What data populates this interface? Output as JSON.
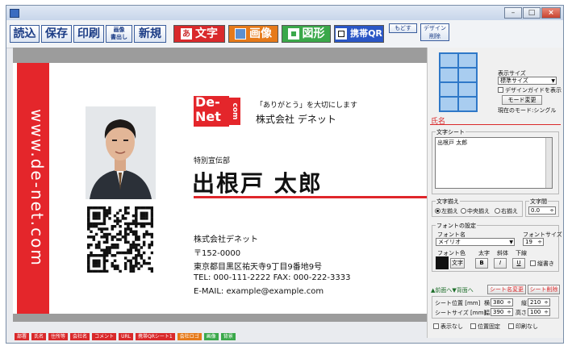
{
  "toolbar": {
    "load": "読込",
    "save": "保存",
    "print": "印刷",
    "export_image_l1": "画像",
    "export_image_l2": "書出し",
    "new": "新規",
    "text_icon": "あ",
    "text": "文字",
    "image": "画像",
    "shape": "図形",
    "qr": "携帯QR",
    "undo": "もどす",
    "design_delete_l1": "デザイン",
    "design_delete_l2": "削除"
  },
  "card": {
    "url": "www.de-net.com",
    "logo_line1": "De-",
    "logo_line2": "Net",
    "logo_com": "com",
    "tagline": "「ありがとう」を大切にします",
    "company_header": "株式会社 デネット",
    "department": "特別宣伝部",
    "name": "出根戸 太郎",
    "company": "株式会社デネット",
    "postal": "〒152-0000",
    "address": "東京都目黒区祐天寺9丁目9番地9号",
    "tel_fax": "TEL: 000-111-2222  FAX: 000-222-3333",
    "email": "E-MAIL: example@example.com"
  },
  "panel": {
    "display_size_label": "表示サイズ",
    "display_size_value": "標準サイズ",
    "design_guide": "デザインガイドを表示",
    "mode_change": "モード変更",
    "current_mode": "現在のモード:シングル",
    "section_name": "氏名",
    "text_sheet_label": "文字シート",
    "text_sheet_value": "出根戸 太郎",
    "align_label": "文字揃え",
    "align_left": "左揃え",
    "align_center": "中央揃え",
    "align_right": "右揃え",
    "spacing_label": "文字間",
    "spacing_value": "0.0",
    "font_settings_label": "フォントの設定",
    "font_name_label": "フォント名",
    "font_name_value": "メイリオ",
    "font_size_label": "フォントサイズ",
    "font_size_value": "19",
    "font_color_label": "フォント色",
    "bold_label": "太字",
    "italic_label": "斜体",
    "underline_label": "下線",
    "font_color_btn": "文字",
    "bold_btn": "B",
    "italic_btn": "I",
    "underline_btn": "U",
    "vertical_label": "縦書き",
    "nav_front_back": "▲前面へ▼背面へ",
    "rename_sheet": "シート名変更",
    "delete_sheet": "シート削除",
    "sheet_pos_label": "シート位置 [mm]",
    "horiz_label": "横",
    "vert_label": "縦",
    "pos_x": "380",
    "pos_y": "210",
    "sheet_size_label": "シートサイズ [mm]",
    "width_label": "幅",
    "height_label": "高さ",
    "size_w": "390",
    "size_h": "100",
    "hide_label": "表示なし",
    "lock_pos_label": "位置固定",
    "no_print_label": "印刷なし"
  },
  "tags": [
    {
      "label": "部署",
      "color": "#d9292b"
    },
    {
      "label": "氏名",
      "color": "#d9292b"
    },
    {
      "label": "住所等",
      "color": "#d9292b"
    },
    {
      "label": "会社名",
      "color": "#d9292b"
    },
    {
      "label": "コメント",
      "color": "#d9292b"
    },
    {
      "label": "URL",
      "color": "#d9292b"
    },
    {
      "label": "携帯QRシート1",
      "color": "#d9292b"
    },
    {
      "label": "会社ロゴ",
      "color": "#e67a1a"
    },
    {
      "label": "画像",
      "color": "#3aa84a"
    },
    {
      "label": "背景",
      "color": "#3aa84a"
    }
  ],
  "colors": {
    "accent_red": "#e4262b",
    "text_btn": "#d9292b",
    "image_btn": "#e67a1a",
    "shape_btn": "#3aa84a",
    "toolbar_blue": "#1c3d86"
  }
}
